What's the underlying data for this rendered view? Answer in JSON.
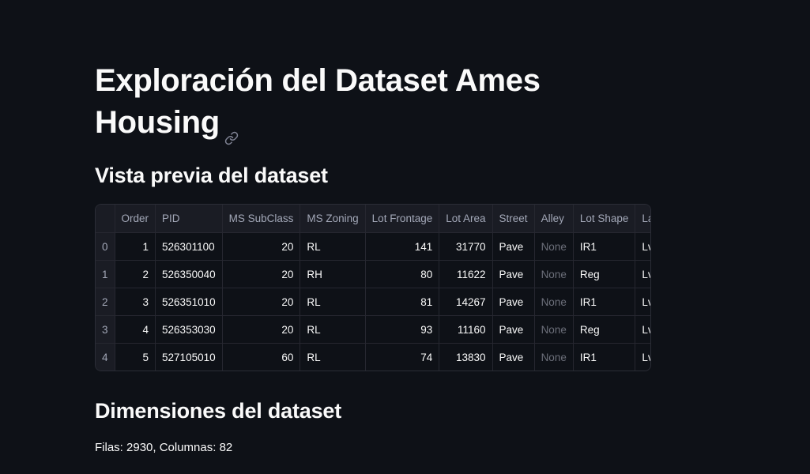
{
  "header": {
    "title": "Exploración del Dataset Ames Housing"
  },
  "sections": {
    "preview_title": "Vista previa del dataset",
    "dims_title": "Dimensiones del dataset",
    "dims_text": "Filas: 2930, Columnas: 82"
  },
  "table": {
    "columns": [
      "",
      "Order",
      "PID",
      "MS SubClass",
      "MS Zoning",
      "Lot Frontage",
      "Lot Area",
      "Street",
      "Alley",
      "Lot Shape",
      "Land Contour"
    ],
    "rows": [
      [
        "0",
        "1",
        "526301100",
        "20",
        "RL",
        "141",
        "31770",
        "Pave",
        "None",
        "IR1",
        "Lvl"
      ],
      [
        "1",
        "2",
        "526350040",
        "20",
        "RH",
        "80",
        "11622",
        "Pave",
        "None",
        "Reg",
        "Lvl"
      ],
      [
        "2",
        "3",
        "526351010",
        "20",
        "RL",
        "81",
        "14267",
        "Pave",
        "None",
        "IR1",
        "Lvl"
      ],
      [
        "3",
        "4",
        "526353030",
        "20",
        "RL",
        "93",
        "11160",
        "Pave",
        "None",
        "Reg",
        "Lvl"
      ],
      [
        "4",
        "5",
        "527105010",
        "60",
        "RL",
        "74",
        "13830",
        "Pave",
        "None",
        "IR1",
        "Lvl"
      ]
    ]
  }
}
